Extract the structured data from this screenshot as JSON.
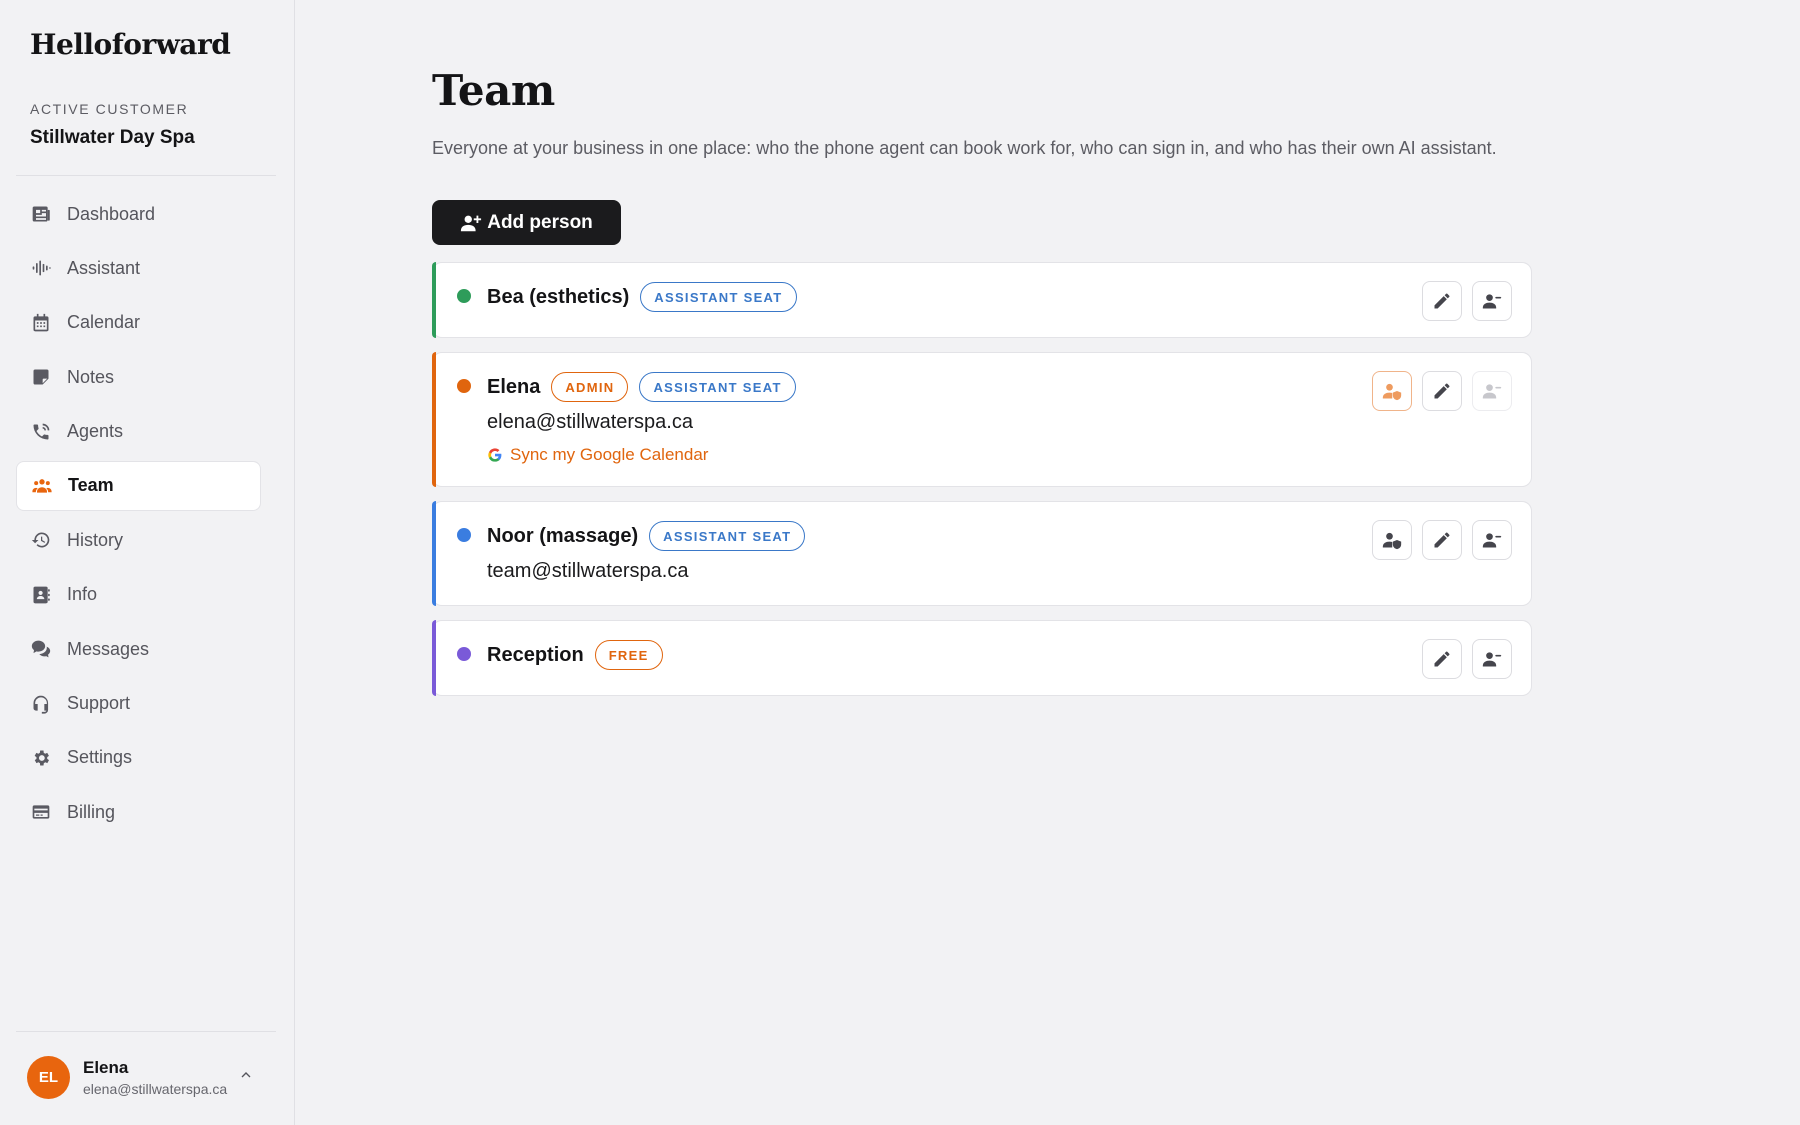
{
  "brand": "Helloforward",
  "customer": {
    "caption": "ACTIVE CUSTOMER",
    "name": "Stillwater Day Spa"
  },
  "nav": {
    "items": [
      {
        "label": "Dashboard",
        "icon": "dashboard-icon"
      },
      {
        "label": "Assistant",
        "icon": "waveform-icon"
      },
      {
        "label": "Calendar",
        "icon": "calendar-icon"
      },
      {
        "label": "Notes",
        "icon": "note-icon"
      },
      {
        "label": "Agents",
        "icon": "phone-icon"
      },
      {
        "label": "Team",
        "icon": "team-icon",
        "active": true
      },
      {
        "label": "History",
        "icon": "history-icon"
      },
      {
        "label": "Info",
        "icon": "contact-card-icon"
      },
      {
        "label": "Messages",
        "icon": "chat-icon"
      },
      {
        "label": "Support",
        "icon": "headset-icon"
      },
      {
        "label": "Settings",
        "icon": "gear-icon"
      },
      {
        "label": "Billing",
        "icon": "credit-card-icon"
      }
    ]
  },
  "user": {
    "initials": "EL",
    "name": "Elena",
    "email": "elena@stillwaterspa.ca"
  },
  "page": {
    "title": "Team",
    "subtitle": "Everyone at your business in one place: who the phone agent can book work for, who can sign in, and who has their own AI assistant.",
    "add_button": "Add person"
  },
  "people": [
    {
      "name": "Bea (esthetics)",
      "color": "#2e9c5a",
      "badges": {
        "seat": "ASSISTANT SEAT"
      }
    },
    {
      "name": "Elena",
      "color": "#e0650e",
      "email": "elena@stillwaterspa.ca",
      "sync_label": "Sync my Google Calendar",
      "badges": {
        "admin": "ADMIN",
        "seat": "ASSISTANT SEAT"
      }
    },
    {
      "name": "Noor (massage)",
      "color": "#3a7de0",
      "email": "team@stillwaterspa.ca",
      "badges": {
        "seat": "ASSISTANT SEAT"
      }
    },
    {
      "name": "Reception",
      "color": "#7a5ad8",
      "badges": {
        "free": "FREE"
      }
    }
  ],
  "colors": {
    "accent": "#e8650e",
    "seat_badge": "#3a78c8",
    "primary_button": "#1b1b1d"
  }
}
